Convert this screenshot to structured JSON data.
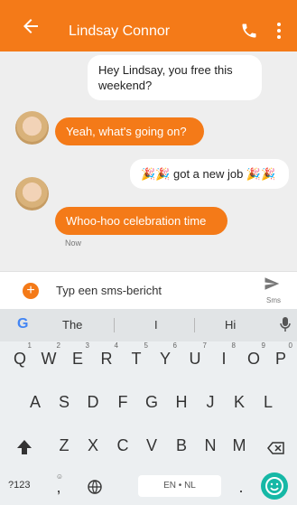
{
  "app": {
    "contact": "Lindsay Connor"
  },
  "messages": [
    {
      "dir": "out",
      "text": "Hey Lindsay, you free this weekend?"
    },
    {
      "dir": "in",
      "text": "Yeah, what's going on?"
    },
    {
      "dir": "out",
      "text": "🎉🎉 got a new job 🎉🎉"
    },
    {
      "dir": "in",
      "text": "Whoo-hoo celebration time"
    }
  ],
  "status": {
    "time": "Now"
  },
  "composer": {
    "placeholder": "Typ een sms-bericht",
    "send_label": "Sms"
  },
  "keyboard": {
    "suggestions": [
      "The",
      "I",
      "Hi"
    ],
    "row1": [
      "Q",
      "W",
      "E",
      "R",
      "T",
      "Y",
      "U",
      "I",
      "O",
      "P"
    ],
    "row1_hints": [
      "1",
      "2",
      "3",
      "4",
      "5",
      "6",
      "7",
      "8",
      "9",
      "0"
    ],
    "row2": [
      "A",
      "S",
      "D",
      "F",
      "G",
      "H",
      "J",
      "K",
      "L"
    ],
    "row3": [
      "Z",
      "X",
      "C",
      "V",
      "B",
      "N",
      "M"
    ],
    "bottom": {
      "symbols": "?123",
      "comma": ",",
      "comma_hint": "☺",
      "space": "EN • NL",
      "period": "."
    }
  },
  "colors": {
    "accent": "#f47a18",
    "emoji_button": "#16b8a6"
  },
  "icons": [
    "back-icon",
    "phone-icon",
    "more-icon",
    "add-icon",
    "send-icon",
    "google-icon",
    "mic-icon",
    "shift-icon",
    "backspace-icon",
    "globe-icon",
    "emoji-icon"
  ]
}
